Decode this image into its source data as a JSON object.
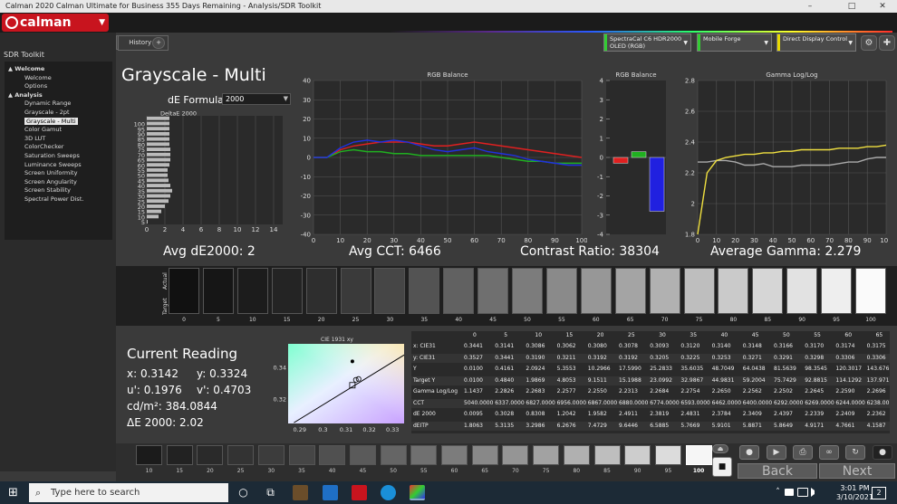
{
  "window": {
    "title": "Calman 2020 Calman Ultimate for Business 355 Days Remaining  - Analysis/SDR Toolkit",
    "minimize": "–",
    "maximize": "□",
    "close": "✕"
  },
  "brand": {
    "logo_text": "calman",
    "menu_arrow": "▼"
  },
  "sidebar": {
    "title": "SDR Toolkit",
    "items": [
      {
        "label": "▲ Welcome",
        "group": true
      },
      {
        "label": "Welcome"
      },
      {
        "label": "Options"
      },
      {
        "label": "▲ Analysis",
        "group": true
      },
      {
        "label": "Dynamic Range"
      },
      {
        "label": "Grayscale - 2pt"
      },
      {
        "label": "Grayscale - Multi",
        "selected": true
      },
      {
        "label": "Color Gamut"
      },
      {
        "label": "3D LUT"
      },
      {
        "label": "ColorChecker"
      },
      {
        "label": "Saturation Sweeps"
      },
      {
        "label": "Luminance Sweeps"
      },
      {
        "label": "Screen Uniformity"
      },
      {
        "label": "Screen Angularity"
      },
      {
        "label": "Screen Stability"
      },
      {
        "label": "Spectral Power Dist."
      }
    ]
  },
  "tabs": {
    "back": "◀",
    "history": "History 1",
    "add": "+"
  },
  "devices": [
    {
      "line1": "SpectraCal C6 HDR2000",
      "line2": "OLED (RGB)",
      "color": "#33cc33"
    },
    {
      "line1": "Mobile Forge",
      "line2": "",
      "color": "#33cc33"
    },
    {
      "line1": "Direct Display Control",
      "line2": "",
      "color": "#e8d800"
    }
  ],
  "device_arrow": "▼",
  "toolbar": {
    "settings_icon": "⚙",
    "expand_icon": "✚"
  },
  "page": {
    "title": "Grayscale - Multi",
    "de_formula_label": "dE Formula:",
    "de_formula_value": "2000",
    "select_arrow": "▼"
  },
  "stats": {
    "avg_de": "Avg dE2000: 2",
    "avg_cct": "Avg CCT: 6466",
    "contrast": "Contrast Ratio: 38304",
    "gamma": "Average Gamma: 2.279"
  },
  "chart_data": [
    {
      "type": "bar",
      "orientation": "horizontal",
      "title": "DeltaE 2000",
      "categories": [
        "0",
        "5",
        "10",
        "15",
        "20",
        "25",
        "30",
        "35",
        "40",
        "45",
        "50",
        "55",
        "60",
        "65",
        "70",
        "75",
        "80",
        "85",
        "90",
        "95",
        "100"
      ],
      "values": [
        0.1,
        1.3,
        1.6,
        2.0,
        2.4,
        2.6,
        2.8,
        2.6,
        2.4,
        2.3,
        2.3,
        2.5,
        2.6,
        2.6,
        2.6,
        2.5,
        2.5,
        2.5,
        2.5,
        2.5,
        2.5
      ],
      "y_ticks": [
        "5",
        "10",
        "15",
        "20",
        "25",
        "30",
        "35",
        "40",
        "45",
        "50",
        "55",
        "60",
        "65",
        "70",
        "75",
        "80",
        "85",
        "90",
        "95",
        "100"
      ],
      "x_ticks": [
        "0",
        "2",
        "4",
        "6",
        "8",
        "10",
        "12",
        "14"
      ],
      "xlim": [
        0,
        15
      ],
      "grid": true
    },
    {
      "type": "line",
      "title": "RGB Balance",
      "x": [
        0,
        5,
        10,
        15,
        20,
        25,
        30,
        35,
        40,
        45,
        50,
        55,
        60,
        65,
        70,
        75,
        80,
        85,
        90,
        95,
        100
      ],
      "series": [
        {
          "color": "#e02020",
          "values": [
            0,
            0,
            4,
            6,
            7,
            8,
            8,
            8,
            7,
            6,
            6,
            7,
            8,
            7,
            6,
            5,
            4,
            3,
            2,
            1,
            0
          ]
        },
        {
          "color": "#20b020",
          "values": [
            0,
            0,
            3,
            4,
            3,
            3,
            2,
            2,
            1,
            1,
            1,
            1,
            1,
            1,
            0,
            -1,
            -2,
            -2,
            -3,
            -3,
            -3
          ]
        },
        {
          "color": "#2030e0",
          "values": [
            0,
            0,
            5,
            8,
            9,
            8,
            9,
            8,
            6,
            4,
            3,
            4,
            5,
            3,
            2,
            1,
            -1,
            -2,
            -3,
            -4,
            -4
          ]
        }
      ],
      "x_ticks": [
        "0",
        "10",
        "20",
        "30",
        "40",
        "50",
        "60",
        "70",
        "80",
        "90",
        "100"
      ],
      "y_ticks": [
        "40",
        "30",
        "20",
        "10",
        "0",
        "-10",
        "-20",
        "-30",
        "-40"
      ],
      "ylim": [
        -40,
        40
      ],
      "grid": true
    },
    {
      "type": "bar",
      "title": "RGB Balance",
      "categories": [
        "R",
        "G",
        "B"
      ],
      "values": [
        -0.3,
        0.3,
        -2.8
      ],
      "colors": [
        "#e02020",
        "#20b020",
        "#2020e0"
      ],
      "y_ticks": [
        "4",
        "3",
        "2",
        "1",
        "0",
        "-1",
        "-2",
        "-3",
        "-4"
      ],
      "ylim": [
        -4,
        4
      ]
    },
    {
      "type": "line",
      "title": "Gamma Log/Log",
      "x": [
        0,
        5,
        10,
        15,
        20,
        25,
        30,
        35,
        40,
        45,
        50,
        55,
        60,
        65,
        70,
        75,
        80,
        85,
        90,
        95,
        100
      ],
      "series": [
        {
          "color": "#aaaaaa",
          "values": [
            2.27,
            2.27,
            2.28,
            2.28,
            2.27,
            2.25,
            2.25,
            2.26,
            2.24,
            2.24,
            2.24,
            2.25,
            2.25,
            2.25,
            2.25,
            2.26,
            2.27,
            2.27,
            2.29,
            2.3,
            2.3
          ]
        },
        {
          "color": "#f0e040",
          "values": [
            1.8,
            2.2,
            2.28,
            2.3,
            2.31,
            2.32,
            2.32,
            2.33,
            2.33,
            2.34,
            2.34,
            2.35,
            2.35,
            2.35,
            2.35,
            2.36,
            2.36,
            2.36,
            2.37,
            2.37,
            2.38
          ]
        }
      ],
      "x_ticks": [
        "0",
        "10",
        "20",
        "30",
        "40",
        "50",
        "60",
        "70",
        "80",
        "90",
        "100"
      ],
      "y_ticks": [
        "2.8",
        "2.6",
        "2.4",
        "2.2",
        "2",
        "1.8"
      ],
      "ylim": [
        1.8,
        2.8
      ],
      "grid": true
    },
    {
      "type": "scatter",
      "title": "CIE 1931 xy",
      "x_ticks": [
        "0.29",
        "0.3",
        "0.31",
        "0.32",
        "0.33"
      ],
      "y_ticks": [
        "0.34",
        "0.32"
      ],
      "xlim": [
        0.285,
        0.335
      ],
      "ylim": [
        0.305,
        0.355
      ],
      "target": {
        "x": 0.3127,
        "y": 0.329
      },
      "measured": {
        "x": 0.3142,
        "y": 0.3324
      },
      "white_point": {
        "x": 0.3127,
        "y": 0.344
      }
    }
  ],
  "strip": {
    "actual_label": "Actual",
    "target_label": "Target",
    "levels": [
      "0",
      "5",
      "10",
      "15",
      "20",
      "25",
      "30",
      "35",
      "40",
      "45",
      "50",
      "55",
      "60",
      "65",
      "70",
      "75",
      "80",
      "85",
      "90",
      "95",
      "100"
    ],
    "colors": [
      "#111111",
      "#161616",
      "#1c1c1c",
      "#242424",
      "#2e2e2e",
      "#3a3a3a",
      "#464646",
      "#535353",
      "#616161",
      "#6f6f6f",
      "#7c7c7c",
      "#8a8a8a",
      "#979797",
      "#a4a4a4",
      "#b1b1b1",
      "#bebebe",
      "#cacaca",
      "#d6d6d6",
      "#e2e2e2",
      "#eeeeee",
      "#fafafa"
    ]
  },
  "reading": {
    "title": "Current Reading",
    "x": "x: 0.3142",
    "y": "y: 0.3324",
    "u": "u': 0.1976",
    "v": "v': 0.4703",
    "cdm2": "cd/m²: 384.0844",
    "de2000": "ΔE 2000: 2.02"
  },
  "table": {
    "columns": [
      "0",
      "5",
      "10",
      "15",
      "20",
      "25",
      "30",
      "35",
      "40",
      "45",
      "50",
      "55",
      "60",
      "65"
    ],
    "rows": [
      {
        "label": "x: CIE31",
        "values": [
          "0.3441",
          "0.3141",
          "0.3086",
          "0.3062",
          "0.3080",
          "0.3078",
          "0.3093",
          "0.3120",
          "0.3140",
          "0.3148",
          "0.3166",
          "0.3170",
          "0.3174",
          "0.3175"
        ]
      },
      {
        "label": "y: CIE31",
        "values": [
          "0.3527",
          "0.3441",
          "0.3190",
          "0.3211",
          "0.3192",
          "0.3192",
          "0.3205",
          "0.3225",
          "0.3253",
          "0.3271",
          "0.3291",
          "0.3298",
          "0.3306",
          "0.3306"
        ]
      },
      {
        "label": "Y",
        "values": [
          "0.0100",
          "0.4161",
          "2.0924",
          "5.3553",
          "10.2966",
          "17.5990",
          "25.2833",
          "35.6035",
          "48.7049",
          "64.0438",
          "81.5639",
          "98.3545",
          "120.3017",
          "143.676"
        ]
      },
      {
        "label": "Target Y",
        "values": [
          "0.0100",
          "0.4840",
          "1.9869",
          "4.8053",
          "9.1511",
          "15.1988",
          "23.0992",
          "32.9867",
          "44.9831",
          "59.2004",
          "75.7429",
          "92.8815",
          "114.1292",
          "137.971"
        ]
      },
      {
        "label": "Gamma Log/Log",
        "values": [
          "1.1437",
          "2.2826",
          "2.2683",
          "2.2577",
          "2.2550",
          "2.2313",
          "2.2684",
          "2.2754",
          "2.2650",
          "2.2562",
          "2.2502",
          "2.2645",
          "2.2590",
          "2.2696"
        ]
      },
      {
        "label": "CCT",
        "values": [
          "5040.0000",
          "6337.0000",
          "6827.0000",
          "6956.0000",
          "6867.0000",
          "6880.0000",
          "6774.0000",
          "6593.0000",
          "6462.0000",
          "6400.0000",
          "6292.0000",
          "6269.0000",
          "6244.0000",
          "6238.00"
        ]
      },
      {
        "label": "dE 2000",
        "values": [
          "0.0095",
          "0.3028",
          "0.8308",
          "1.2042",
          "1.9582",
          "2.4911",
          "2.3819",
          "2.4831",
          "2.3784",
          "2.3409",
          "2.4397",
          "2.2339",
          "2.2409",
          "2.2362"
        ]
      },
      {
        "label": "dEITP",
        "values": [
          "1.8063",
          "5.3135",
          "3.2986",
          "6.2676",
          "7.4729",
          "9.6446",
          "6.5885",
          "5.7669",
          "5.9101",
          "5.8871",
          "5.8649",
          "4.9171",
          "4.7661",
          "4.1587"
        ]
      }
    ]
  },
  "swatches": {
    "levels": [
      "10",
      "15",
      "20",
      "25",
      "30",
      "35",
      "40",
      "45",
      "50",
      "55",
      "60",
      "65",
      "70",
      "75",
      "80",
      "85",
      "90",
      "95",
      "100"
    ],
    "colors": [
      "#1b1b1b",
      "#222222",
      "#2a2a2a",
      "#333333",
      "#3c3c3c",
      "#464646",
      "#505050",
      "#5a5a5a",
      "#656565",
      "#707070",
      "#7c7c7c",
      "#888888",
      "#959595",
      "#a2a2a2",
      "#b0b0b0",
      "#bebebe",
      "#cdcdcd",
      "#dcdcdc",
      "#f6f6f6"
    ],
    "active": "100"
  },
  "controls": {
    "back": "Back",
    "next": "Next",
    "eject_icon": "⏏",
    "stop_icon": "■",
    "record_icon": "●",
    "play_icon": "▶",
    "save_icon": "⎙",
    "loop_icon": "∞",
    "refresh_icon": "↻"
  },
  "taskbar": {
    "start_icon": "⊞",
    "search_icon": "⌕",
    "search_placeholder": "Type here to search",
    "cortana_icon": "○",
    "taskview_icon": "⧉",
    "time": "3:01 PM",
    "date": "3/10/2021",
    "notification_count": "2",
    "chevron_icon": "˄"
  }
}
